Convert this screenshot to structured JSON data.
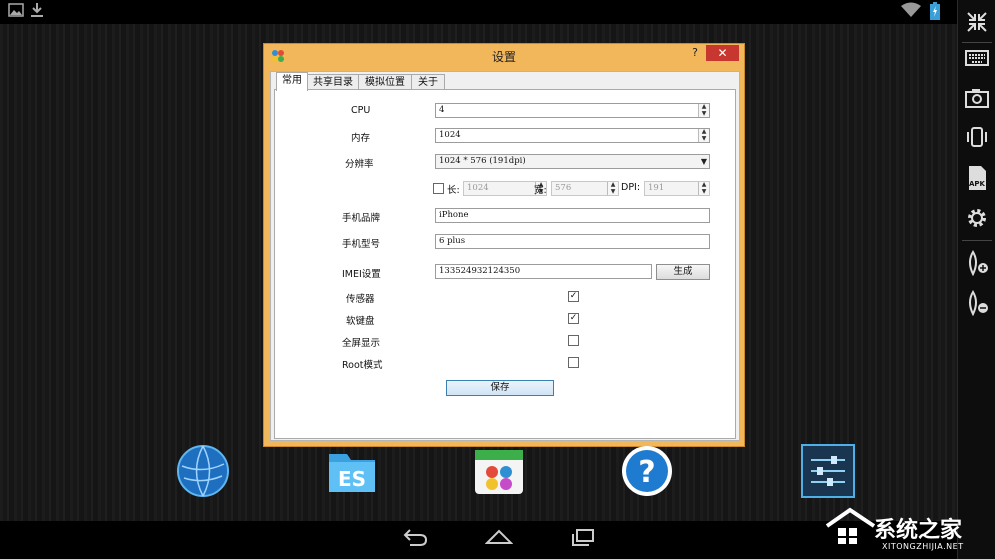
{
  "statusbar": {
    "icons": [
      "image-icon",
      "download-icon",
      "wifi-icon",
      "battery-icon"
    ]
  },
  "dialog": {
    "title": "设置",
    "help": "?",
    "close": "✕",
    "tabs": [
      "常用",
      "共享目录",
      "模拟位置",
      "关于"
    ],
    "cpu": {
      "label": "CPU",
      "value": "4"
    },
    "memory": {
      "label": "内存",
      "value": "1024"
    },
    "resolution": {
      "label": "分辨率",
      "value": "1024 * 576 (191dpi)"
    },
    "custom": {
      "length_label": "长:",
      "length_value": "1024",
      "width_label": "宽:",
      "width_value": "576",
      "dpi_label": "DPI:",
      "dpi_value": "191"
    },
    "brand": {
      "label": "手机品牌",
      "value": "iPhone"
    },
    "model": {
      "label": "手机型号",
      "value": "6 plus"
    },
    "imei": {
      "label": "IMEI设置",
      "value": "133524932124350",
      "generate": "生成"
    },
    "sensor": {
      "label": "传感器",
      "checked": true
    },
    "soft_keyboard": {
      "label": "软键盘",
      "checked": true
    },
    "fullscreen": {
      "label": "全屏显示",
      "checked": false
    },
    "root": {
      "label": "Root模式",
      "checked": false
    },
    "save": "保存"
  },
  "dock": [
    "browser-globe-icon",
    "es-file-explorer-icon",
    "app-store-icon",
    "help-icon",
    "settings-sliders-icon"
  ],
  "sidebar": [
    "shrink-icon",
    "keyboard-icon",
    "camera-icon",
    "shake-icon",
    "apk-icon",
    "gear-icon",
    "volume-up-icon",
    "volume-down-icon"
  ],
  "navbar": [
    "back-icon",
    "home-icon",
    "recents-icon"
  ],
  "watermark": {
    "main": "系统之家",
    "sub": "XITONGZHIJIA.NET"
  },
  "colors": {
    "dialog_frame": "#f2b65b",
    "close": "#c7372f",
    "accent": "#2f8fd3"
  }
}
